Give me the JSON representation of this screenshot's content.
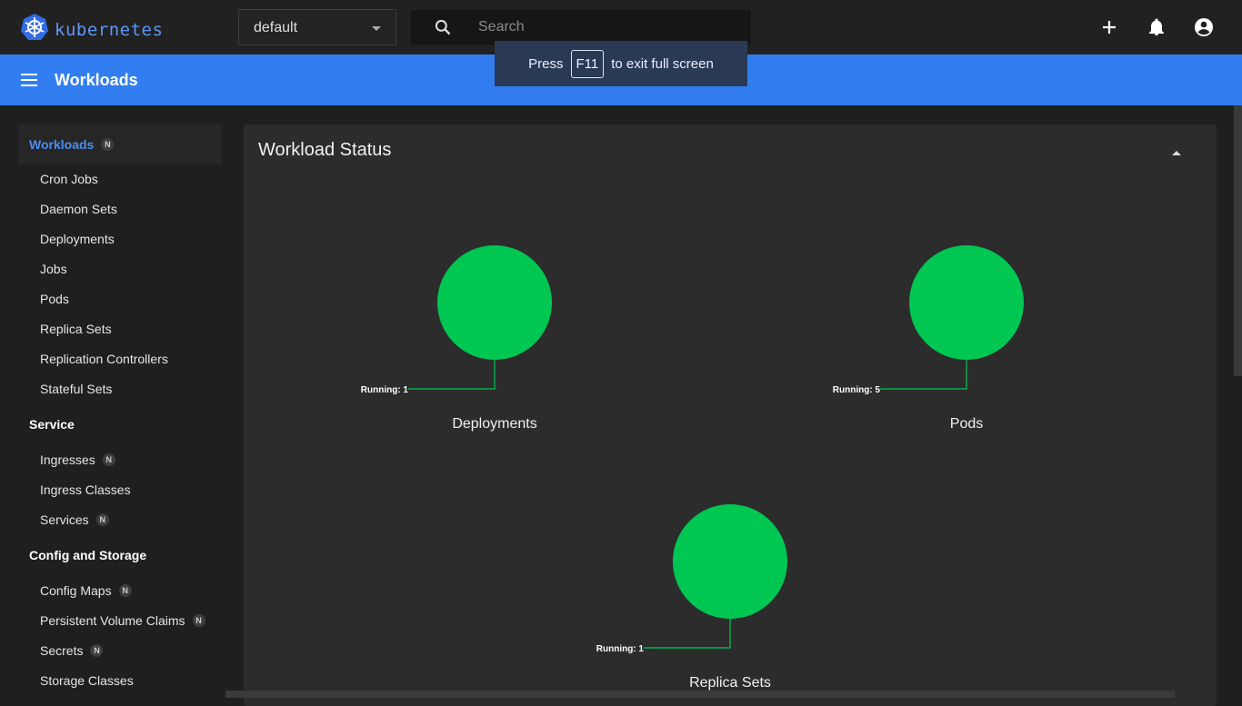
{
  "app": {
    "logo_text": "kubernetes"
  },
  "topbar": {
    "namespace": "default",
    "search_placeholder": "Search",
    "icons": [
      "plus-icon",
      "bell-icon",
      "account-icon"
    ]
  },
  "toast": {
    "pre": "Press",
    "key": "F11",
    "post": "to exit full screen"
  },
  "header": {
    "title": "Workloads"
  },
  "sidebar": {
    "workloads": {
      "label": "Workloads",
      "badge": "N"
    },
    "workload_items": [
      "Cron Jobs",
      "Daemon Sets",
      "Deployments",
      "Jobs",
      "Pods",
      "Replica Sets",
      "Replication Controllers",
      "Stateful Sets"
    ],
    "service": {
      "label": "Service"
    },
    "service_items": [
      {
        "label": "Ingresses",
        "badge": "N"
      },
      {
        "label": "Ingress Classes"
      },
      {
        "label": "Services",
        "badge": "N"
      }
    ],
    "config": {
      "label": "Config and Storage"
    },
    "config_items": [
      {
        "label": "Config Maps",
        "badge": "N"
      },
      {
        "label": "Persistent Volume Claims",
        "badge": "N"
      },
      {
        "label": "Secrets",
        "badge": "N"
      },
      {
        "label": "Storage Classes"
      }
    ]
  },
  "workload_status": {
    "title": "Workload Status",
    "color": "#00c752",
    "charts": [
      {
        "name": "Deployments",
        "status": "Running",
        "value": 1
      },
      {
        "name": "Pods",
        "status": "Running",
        "value": 5
      },
      {
        "name": "Replica Sets",
        "status": "Running",
        "value": 1
      }
    ]
  }
}
